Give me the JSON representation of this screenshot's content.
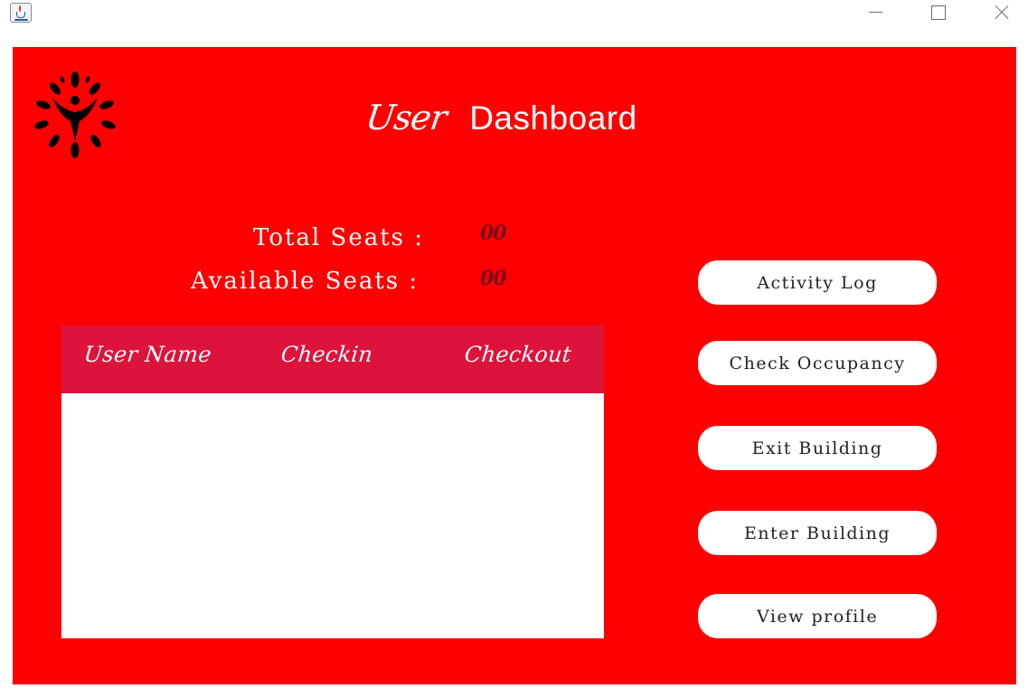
{
  "window": {
    "app_icon": "java-cup-icon",
    "controls": [
      "minimize-icon",
      "maximize-icon",
      "close-icon"
    ]
  },
  "colors": {
    "panel_background": "#ff0000",
    "table_header": "#dc143c",
    "seat_value": "#7a0c1a",
    "button_background": "#ffffff"
  },
  "header": {
    "logo_icon": "leaf-figure-logo",
    "title_first": "User",
    "title_second": "Dashboard"
  },
  "seats": {
    "total_label": "Total Seats :",
    "total_value": "00",
    "available_label": "Available Seats :",
    "available_value": "00"
  },
  "table": {
    "columns": [
      "User Name",
      "Checkin",
      "Checkout"
    ],
    "rows": []
  },
  "buttons": {
    "activity_log": "Activity Log",
    "check_occupancy": "Check Occupancy",
    "exit_building": "Exit Building",
    "enter_building": "Enter Building",
    "view_profile": "View profile"
  }
}
